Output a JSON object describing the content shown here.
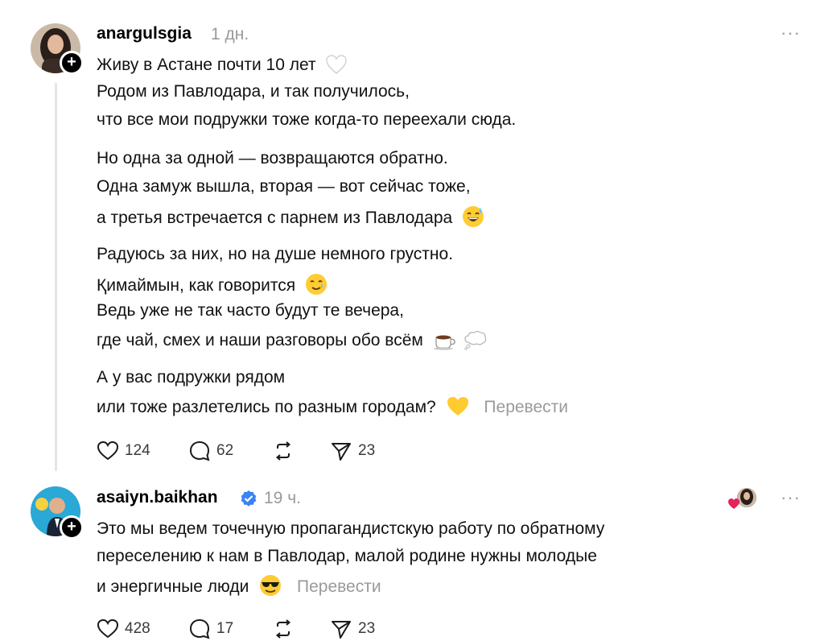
{
  "posts": [
    {
      "username": "anargulsgia",
      "time": "1 дн.",
      "lines": [
        "Живу в Астане почти 10 лет",
        "Родом из Павлодара, и так получилось,",
        "что все мои подружки тоже когда-то переехали сюда.",
        "Но одна за одной — возвращаются обратно.",
        "Одна замуж вышла, вторая — вот сейчас тоже,",
        "а третья встречается с парнем из Павлодара",
        "Радуюсь за них, но на душе немного грустно.",
        "Қимаймын, как говорится",
        "Ведь уже не так часто будут те вечера,",
        "где чай, смех и наши разговоры обо всём",
        "А у вас подружки рядом",
        "или тоже разлетелись по разным городам?"
      ],
      "translate_label": "Перевести",
      "likes": "124",
      "comments": "62",
      "shares": "23"
    },
    {
      "username": "asaiyn.baikhan",
      "time": "19 ч.",
      "verified": true,
      "lines": [
        "Это мы ведем точечную пропагандистскую работу по обратному",
        "переселению к нам в Павлодар, малой родине нужны молодые",
        "и энергичные люди"
      ],
      "translate_label": "Перевести",
      "likes": "428",
      "comments": "17",
      "shares": "23"
    }
  ],
  "more_label": "···",
  "follow_plus": "+",
  "icons": {
    "like": "heart-icon",
    "comment": "comment-icon",
    "repost": "repost-icon",
    "share": "send-icon",
    "more": "more-icon",
    "verified": "verified-badge-icon"
  },
  "colors": {
    "text": "#111111",
    "muted": "#9a9a9a",
    "verified": "#3b82f6",
    "heart": "#e5245a"
  }
}
